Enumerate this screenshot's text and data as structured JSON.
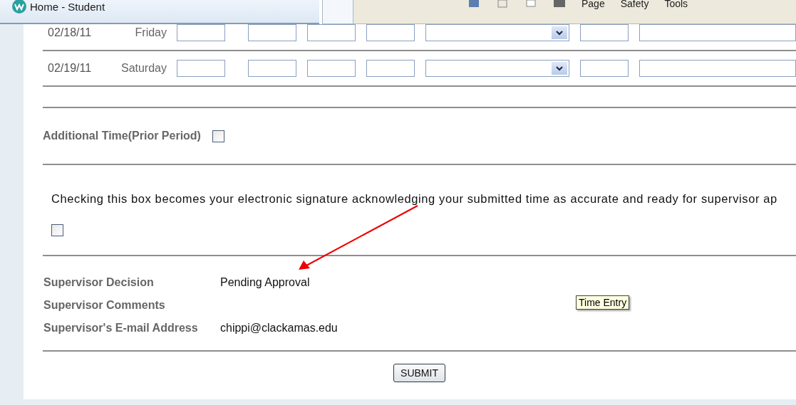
{
  "browser": {
    "tab_title": "Home - Student",
    "toolbar_menus": [
      "Page",
      "Safety",
      "Tools"
    ]
  },
  "time_rows": [
    {
      "date": "02/18/11",
      "day": "Friday"
    },
    {
      "date": "02/19/11",
      "day": "Saturday"
    }
  ],
  "additional_time": {
    "label": "Additional Time(Prior Period)",
    "checked": false
  },
  "signature": {
    "text": "Checking this box becomes your electronic signature acknowledging your submitted time as accurate and ready for supervisor ap",
    "checked": false
  },
  "supervisor": [
    {
      "label": "Supervisor Decision",
      "value": "Pending Approval"
    },
    {
      "label": "Supervisor Comments"
    },
    {
      "label": "Supervisor's E-mail Address",
      "value": "chippi@clackamas.edu"
    }
  ],
  "tooltip": "Time Entry",
  "submit": "SUBMIT"
}
